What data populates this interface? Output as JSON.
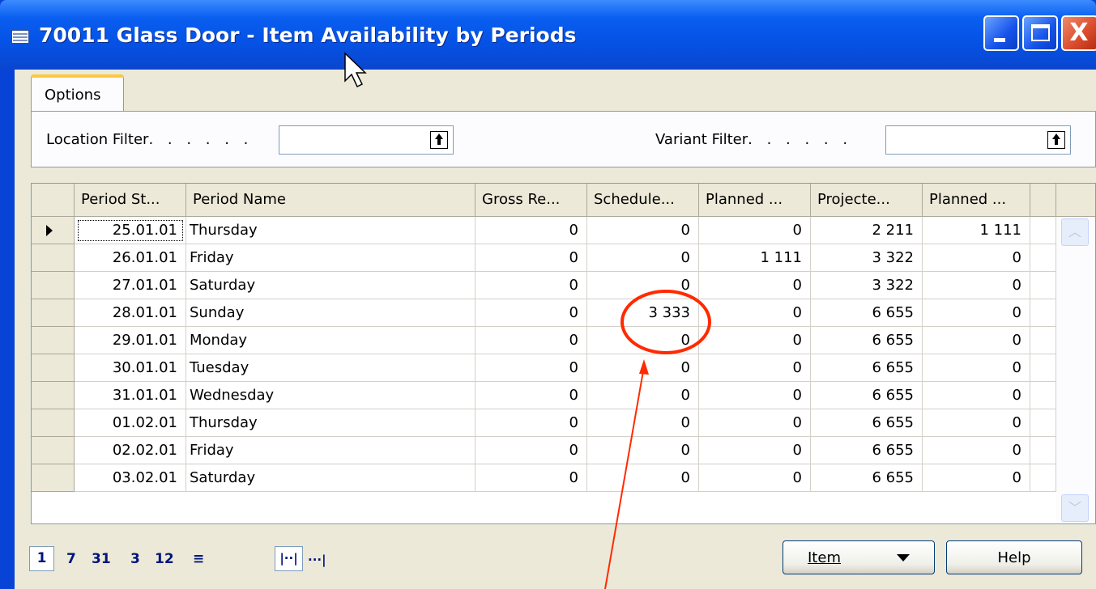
{
  "window": {
    "title": "70011 Glass Door - Item Availability by Periods",
    "close_glyph": "X"
  },
  "options_tab": {
    "label": "Options"
  },
  "filters": {
    "location_label": "Location Filter",
    "location_dots": ". . . . . .",
    "location_value": "",
    "variant_label": "Variant Filter",
    "variant_dots": ". . . . . .",
    "variant_value": ""
  },
  "grid": {
    "columns": [
      "Period St...",
      "Period Name",
      "Gross Re...",
      "Schedule...",
      "Planned ...",
      "Projecte...",
      "Planned ..."
    ],
    "rows": [
      {
        "period_start": "25.01.01",
        "period_name": "Thursday",
        "gross": "0",
        "scheduled": "0",
        "planned_rcpt": "0",
        "projected": "2 211",
        "planned_rel": "1 111",
        "current": true
      },
      {
        "period_start": "26.01.01",
        "period_name": "Friday",
        "gross": "0",
        "scheduled": "0",
        "planned_rcpt": "1 111",
        "projected": "3 322",
        "planned_rel": "0"
      },
      {
        "period_start": "27.01.01",
        "period_name": "Saturday",
        "gross": "0",
        "scheduled": "0",
        "planned_rcpt": "0",
        "projected": "3 322",
        "planned_rel": "0"
      },
      {
        "period_start": "28.01.01",
        "period_name": "Sunday",
        "gross": "0",
        "scheduled": "3 333",
        "planned_rcpt": "0",
        "projected": "6 655",
        "planned_rel": "0"
      },
      {
        "period_start": "29.01.01",
        "period_name": "Monday",
        "gross": "0",
        "scheduled": "0",
        "planned_rcpt": "0",
        "projected": "6 655",
        "planned_rel": "0"
      },
      {
        "period_start": "30.01.01",
        "period_name": "Tuesday",
        "gross": "0",
        "scheduled": "0",
        "planned_rcpt": "0",
        "projected": "6 655",
        "planned_rel": "0"
      },
      {
        "period_start": "31.01.01",
        "period_name": "Wednesday",
        "gross": "0",
        "scheduled": "0",
        "planned_rcpt": "0",
        "projected": "6 655",
        "planned_rel": "0"
      },
      {
        "period_start": "01.02.01",
        "period_name": "Thursday",
        "gross": "0",
        "scheduled": "0",
        "planned_rcpt": "0",
        "projected": "6 655",
        "planned_rel": "0"
      },
      {
        "period_start": "02.02.01",
        "period_name": "Friday",
        "gross": "0",
        "scheduled": "0",
        "planned_rcpt": "0",
        "projected": "6 655",
        "planned_rel": "0"
      },
      {
        "period_start": "03.02.01",
        "period_name": "Saturday",
        "gross": "0",
        "scheduled": "0",
        "planned_rcpt": "0",
        "projected": "6 655",
        "planned_rel": "0"
      }
    ]
  },
  "period_buttons": {
    "day": "1",
    "week": "7",
    "month": "31",
    "quarter": "3",
    "year": "12",
    "period": "≡",
    "net_change": "|··|",
    "balance_at_date": "···|"
  },
  "buttons": {
    "item": "Item",
    "help": "Help"
  },
  "colors": {
    "titlebar": "#0552e6",
    "annotation": "#ff2a00"
  }
}
